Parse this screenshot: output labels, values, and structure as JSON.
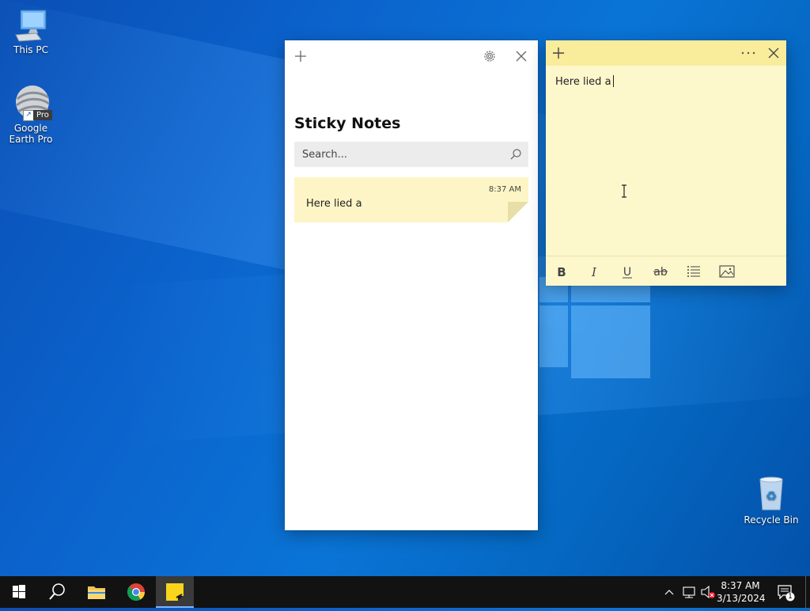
{
  "desktop": {
    "icons": [
      {
        "label": "This PC"
      },
      {
        "label": "Google Earth Pro",
        "badge": "Pro"
      },
      {
        "label": "Recycle Bin"
      }
    ]
  },
  "sticky_list": {
    "title": "Sticky Notes",
    "search_placeholder": "Search...",
    "notes": [
      {
        "time": "8:37 AM",
        "text": "Here lied a"
      }
    ]
  },
  "note_window": {
    "text": "Here lied a",
    "colors": {
      "header": "#f9ec9a",
      "body": "#fdf7cc"
    }
  },
  "taskbar": {
    "time": "8:37 AM",
    "date": "3/13/2024",
    "notification_count": "1",
    "pinned": [
      "start",
      "search",
      "file-explorer",
      "chrome",
      "sticky-notes"
    ]
  }
}
